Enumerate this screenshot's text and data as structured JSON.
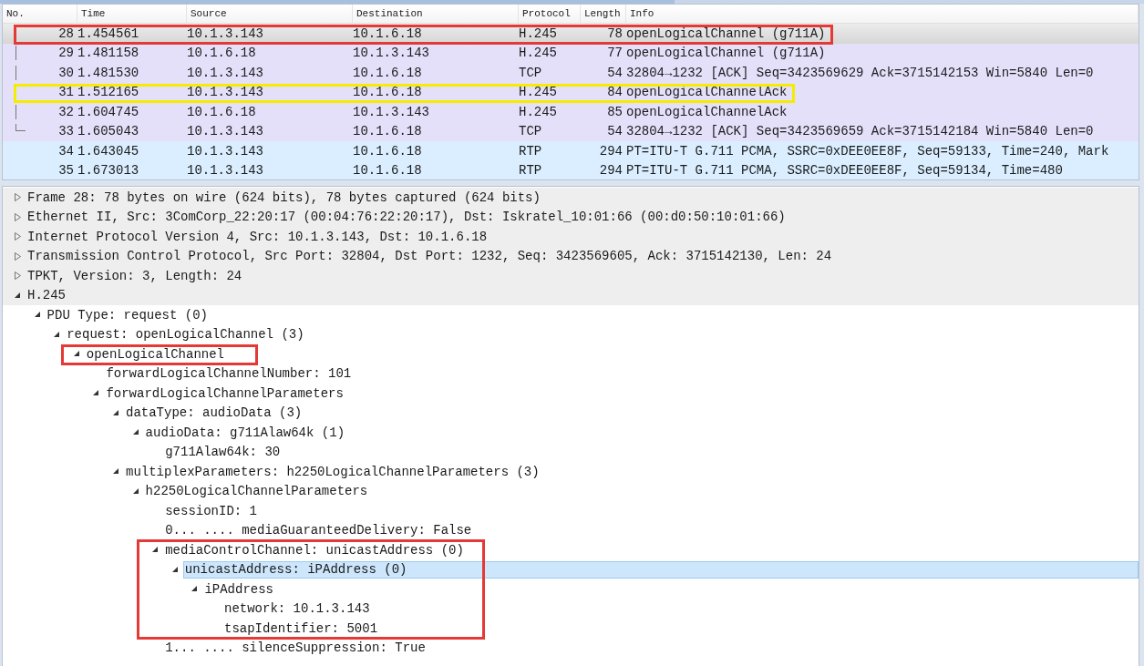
{
  "packet_list": {
    "columns": [
      "No.",
      "Time",
      "Source",
      "Destination",
      "Protocol",
      "Length",
      "Info"
    ],
    "rows": [
      {
        "no": "28",
        "time": "1.454561",
        "source": "10.1.3.143",
        "destination": "10.1.6.18",
        "protocol": "H.245",
        "length": "78",
        "info": "openLogicalChannel (g711A)",
        "selected": true,
        "related": true,
        "outline": {
          "color": "#e53935"
        }
      },
      {
        "no": "29",
        "time": "1.481158",
        "source": "10.1.6.18",
        "destination": "10.1.3.143",
        "protocol": "H.245",
        "length": "77",
        "info": "openLogicalChannel (g711A)",
        "selected": false,
        "color": "#e4e0fa",
        "related": true
      },
      {
        "no": "30",
        "time": "1.481530",
        "source": "10.1.3.143",
        "destination": "10.1.6.18",
        "protocol": "TCP",
        "length": "54",
        "info": "32804→1232 [ACK] Seq=3423569629 Ack=3715142153 Win=5840 Len=0",
        "selected": false,
        "color": "#e4e0fa",
        "related": true
      },
      {
        "no": "31",
        "time": "1.512165",
        "source": "10.1.3.143",
        "destination": "10.1.6.18",
        "protocol": "H.245",
        "length": "84",
        "info": "openLogicalChannelAck",
        "selected": false,
        "color": "#e4e0fa",
        "related": true,
        "outline": {
          "color": "#f5ec00"
        }
      },
      {
        "no": "32",
        "time": "1.604745",
        "source": "10.1.6.18",
        "destination": "10.1.3.143",
        "protocol": "H.245",
        "length": "85",
        "info": "openLogicalChannelAck",
        "selected": false,
        "color": "#e4e0fa",
        "related": true
      },
      {
        "no": "33",
        "time": "1.605043",
        "source": "10.1.3.143",
        "destination": "10.1.6.18",
        "protocol": "TCP",
        "length": "54",
        "info": "32804→1232 [ACK] Seq=3423569659 Ack=3715142184 Win=5840 Len=0",
        "selected": false,
        "color": "#e4e0fa",
        "related": true
      },
      {
        "no": "34",
        "time": "1.643045",
        "source": "10.1.3.143",
        "destination": "10.1.6.18",
        "protocol": "RTP",
        "length": "294",
        "info": "PT=ITU-T G.711 PCMA, SSRC=0xDEE0EE8F, Seq=59133, Time=240, Mark",
        "selected": false,
        "color": "#daeeff",
        "related": false
      },
      {
        "no": "35",
        "time": "1.673013",
        "source": "10.1.3.143",
        "destination": "10.1.6.18",
        "protocol": "RTP",
        "length": "294",
        "info": "PT=ITU-T G.711 PCMA, SSRC=0xDEE0EE8F, Seq=59134, Time=480",
        "selected": false,
        "color": "#daeeff",
        "related": false
      }
    ]
  },
  "packet_details": [
    {
      "label": "Frame 28: 78 bytes on wire (624 bits), 78 bytes captured (624 bits)",
      "expanded": false,
      "selected": false
    },
    {
      "label": "Ethernet II, Src: 3ComCorp_22:20:17 (00:04:76:22:20:17), Dst: Iskratel_10:01:66 (00:d0:50:10:01:66)",
      "expanded": false,
      "selected": false
    },
    {
      "label": "Internet Protocol Version 4, Src: 10.1.3.143, Dst: 10.1.6.18",
      "expanded": false,
      "selected": false
    },
    {
      "label": "Transmission Control Protocol, Src Port: 32804, Dst Port: 1232, Seq: 3423569605, Ack: 3715142130, Len: 24",
      "expanded": false,
      "selected": false
    },
    {
      "label": "TPKT, Version: 3, Length: 24",
      "expanded": false,
      "selected": false
    },
    {
      "label": "H.245",
      "expanded": true,
      "selected": false,
      "children": [
        {
          "label": "PDU Type: request (0)",
          "expanded": true,
          "selected": false,
          "children": [
            {
              "label": "request: openLogicalChannel (3)",
              "expanded": true,
              "selected": false,
              "children": [
                {
                  "label": "openLogicalChannel",
                  "expanded": true,
                  "selected": false,
                  "outline": {
                    "color": "#e53935",
                    "covers_children": false
                  },
                  "children": [
                    {
                      "label": "forwardLogicalChannelNumber: 101",
                      "selected": false
                    },
                    {
                      "label": "forwardLogicalChannelParameters",
                      "expanded": true,
                      "selected": false,
                      "children": [
                        {
                          "label": "dataType: audioData (3)",
                          "expanded": true,
                          "selected": false,
                          "children": [
                            {
                              "label": "audioData: g711Alaw64k (1)",
                              "expanded": true,
                              "selected": false,
                              "children": [
                                {
                                  "label": "g711Alaw64k: 30",
                                  "selected": false
                                }
                              ]
                            }
                          ]
                        },
                        {
                          "label": "multiplexParameters: h2250LogicalChannelParameters (3)",
                          "expanded": true,
                          "selected": false,
                          "children": [
                            {
                              "label": "h2250LogicalChannelParameters",
                              "expanded": true,
                              "selected": false,
                              "children": [
                                {
                                  "label": "sessionID: 1",
                                  "selected": false
                                },
                                {
                                  "label": "0... .... mediaGuaranteedDelivery: False",
                                  "selected": false
                                },
                                {
                                  "label": "mediaControlChannel: unicastAddress (0)",
                                  "expanded": true,
                                  "selected": false,
                                  "outline": {
                                    "color": "#e53935",
                                    "covers_children": true
                                  },
                                  "children": [
                                    {
                                      "label": "unicastAddress: iPAddress (0)",
                                      "expanded": true,
                                      "selected": true,
                                      "children": [
                                        {
                                          "label": "iPAddress",
                                          "expanded": true,
                                          "selected": false,
                                          "children": [
                                            {
                                              "label": "network: 10.1.3.143",
                                              "selected": false
                                            },
                                            {
                                              "label": "tsapIdentifier: 5001",
                                              "selected": false
                                            }
                                          ]
                                        }
                                      ]
                                    }
                                  ]
                                },
                                {
                                  "label": "1... .... silenceSuppression: True",
                                  "selected": false
                                }
                              ]
                            }
                          ]
                        }
                      ]
                    }
                  ]
                }
              ]
            }
          ]
        }
      ]
    }
  ]
}
